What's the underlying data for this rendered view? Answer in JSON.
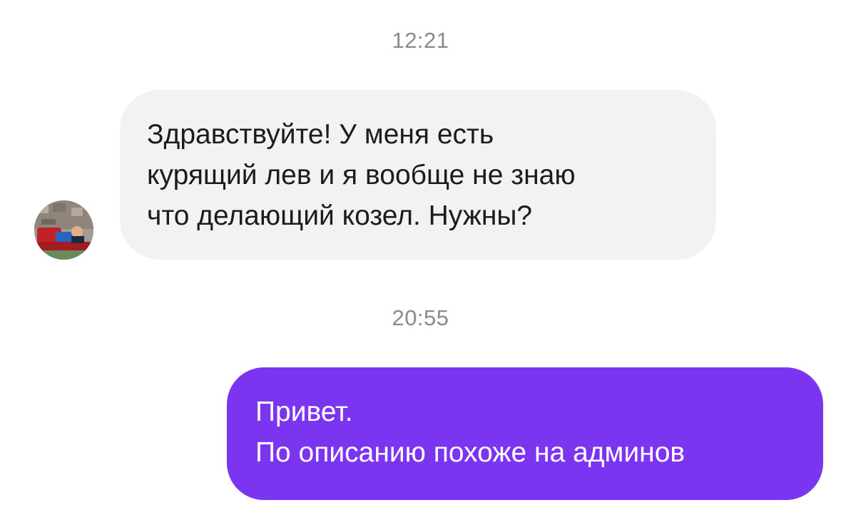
{
  "chat": {
    "messages": [
      {
        "timestamp": "12:21",
        "direction": "incoming",
        "lines": [
          "Здравствуйте! У меня есть",
          "курящий лев и я вообще не знаю",
          "что делающий козел. Нужны?"
        ]
      },
      {
        "timestamp": "20:55",
        "direction": "outgoing",
        "lines": [
          "Привет.",
          "По описанию похоже на админов"
        ]
      }
    ]
  },
  "colors": {
    "incoming_bubble": "#f2f2f4",
    "outgoing_bubble": "#7b35f0",
    "timestamp_text": "#8a8a8e"
  },
  "icons": {
    "sender_avatar": "avatar-photo"
  }
}
